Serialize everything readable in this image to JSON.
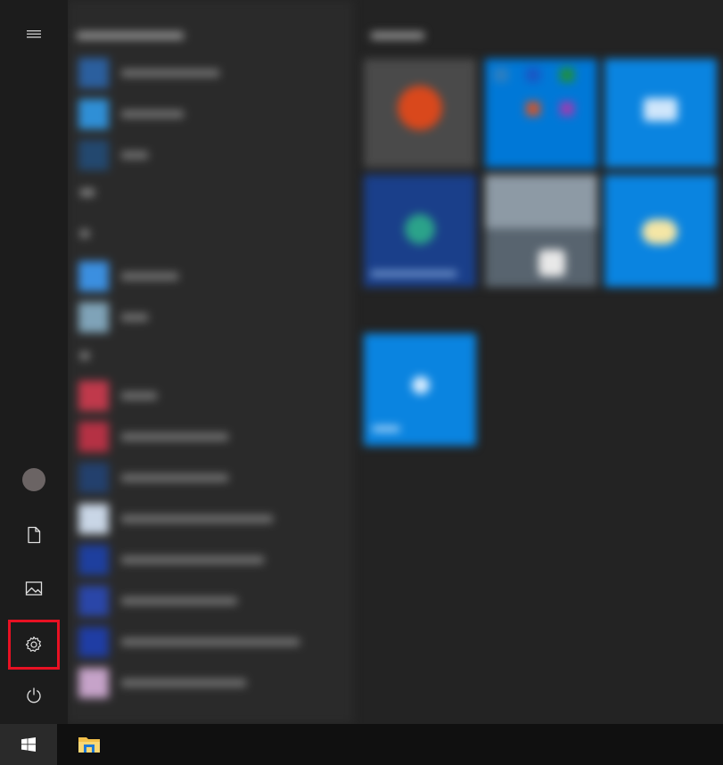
{
  "rail": {
    "items": [
      {
        "name": "hamburger-menu-icon"
      },
      {
        "name": "user-avatar"
      },
      {
        "name": "documents-icon"
      },
      {
        "name": "pictures-icon"
      },
      {
        "name": "settings-icon"
      },
      {
        "name": "power-icon"
      }
    ]
  },
  "taskbar": {
    "items": [
      {
        "name": "windows-start-icon"
      },
      {
        "name": "file-explorer-icon"
      }
    ]
  },
  "colors": {
    "accent": "#0078d7",
    "highlight": "#e81123",
    "rail_bg": "#1c1c1c",
    "taskbar_bg": "#101010"
  }
}
